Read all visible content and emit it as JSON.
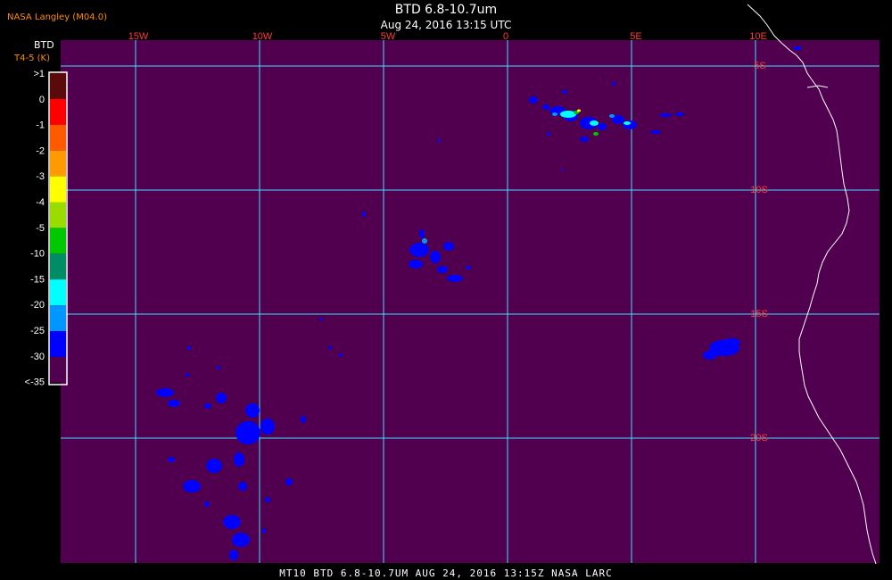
{
  "header": {
    "source": "NASA Langley (M04.0)",
    "title": "BTD 6.8-10.7um",
    "datetime": "Aug 24, 2016 13:15 UTC"
  },
  "colorbar": {
    "title": "BTD",
    "unit": "T4-5 (K)",
    "bins": [
      {
        "label": ">1",
        "color": "#5a0a0a"
      },
      {
        "label": "0",
        "color": "#ff0000"
      },
      {
        "label": "-1",
        "color": "#ff5a00"
      },
      {
        "label": "-2",
        "color": "#ff9a00"
      },
      {
        "label": "-3",
        "color": "#ffff00"
      },
      {
        "label": "-4",
        "color": "#9adc00"
      },
      {
        "label": "-5",
        "color": "#00c800"
      },
      {
        "label": "-10",
        "color": "#008c64"
      },
      {
        "label": "-15",
        "color": "#00ffff"
      },
      {
        "label": "-20",
        "color": "#0096ff"
      },
      {
        "label": "-25",
        "color": "#0000ff"
      },
      {
        "label": "-30",
        "color": "#50004e"
      },
      {
        "label": "<-35",
        "color": ""
      }
    ]
  },
  "map": {
    "background_color": "#50004e",
    "grid_color": "#40e0ff",
    "coast_color": "#ffffff",
    "lon_labels": [
      "15W",
      "10W",
      "5W",
      "0",
      "5E",
      "10E"
    ],
    "lat_labels": [
      "5S",
      "10S",
      "15S",
      "20S"
    ]
  },
  "footer": {
    "text": "MT10  BTD 6.8-10.7UM   AUG 24, 2016 13:15Z   NASA LARC"
  }
}
